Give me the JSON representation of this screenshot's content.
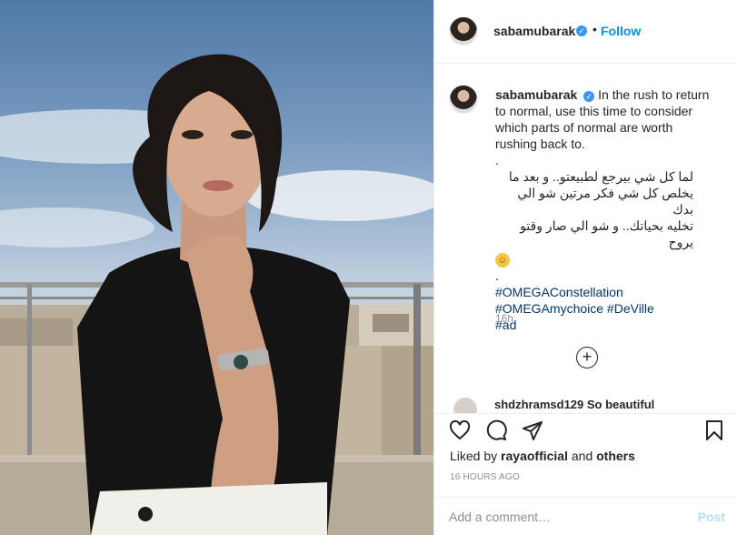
{
  "header": {
    "username": "sabamubarak",
    "separator": "•",
    "follow_label": "Follow"
  },
  "caption": {
    "username": "sabamubarak",
    "english": "In the rush to return to normal, use this time to consider which parts of normal are worth rushing back to.",
    "dot1": ".",
    "arabic": [
      "لما كل شي بيرجع لطبيعتو.. و بعد ما",
      "يخلص كل شي فكر مرتين شو الي بدك",
      "تخليه بحياتك.. و شو الي صار وقتو يروح"
    ],
    "dot2": ".",
    "hashtags": [
      "#OMEGAConstellation",
      "#OMEGAmychoice #DeVille",
      "#ad"
    ],
    "time": "16h"
  },
  "peek_comment": {
    "text": "shdzhramsd129 So beautiful"
  },
  "icons": {
    "like": "heart-icon",
    "comment": "comment-icon",
    "share": "paper-plane-icon",
    "save": "bookmark-icon",
    "load_more": "plus-circle-icon",
    "verified": "verified-badge-icon"
  },
  "likes": {
    "prefix": "Liked by",
    "user": "rayaofficial",
    "and": "and",
    "others": "others"
  },
  "post_time": "16 HOURS AGO",
  "add_comment": {
    "placeholder": "Add a comment…",
    "post_label": "Post"
  },
  "colors": {
    "accent": "#0095f6",
    "verified": "#3897f0",
    "hashtag": "#00376b",
    "muted": "#8e8e8e",
    "post_disabled": "#b2dffc"
  }
}
